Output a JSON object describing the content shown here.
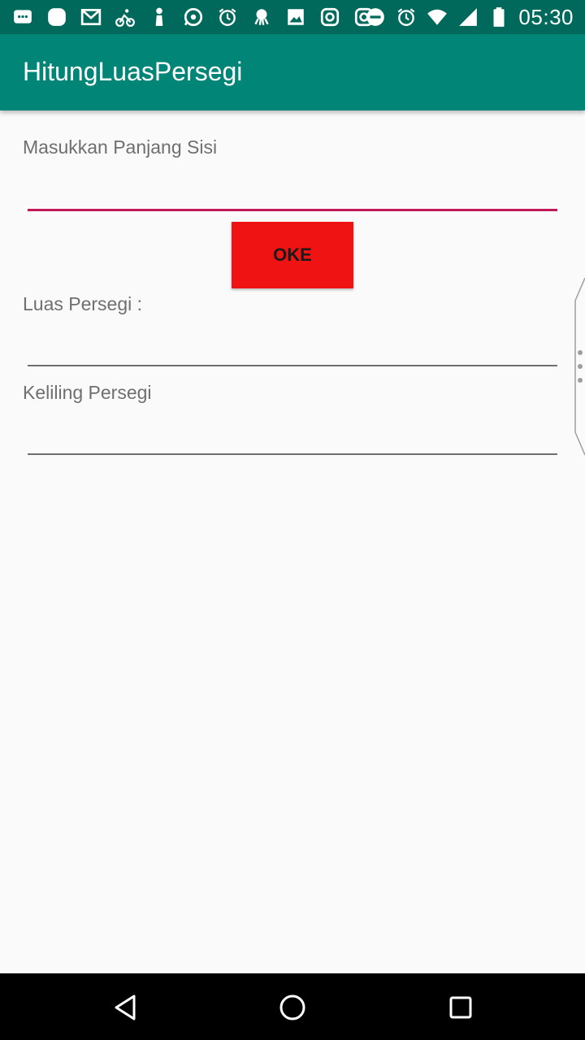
{
  "status_bar": {
    "time": "05:30",
    "icons": [
      "message-icon",
      "blob-icon",
      "gmail-icon",
      "cycling-icon",
      "figure-icon",
      "whatsapp-icon",
      "alarm-icon",
      "octopus-icon",
      "image-icon",
      "instagram-icon",
      "instagram-icon",
      "dnd-icon",
      "alarm-icon",
      "wifi-icon",
      "signal-icon",
      "battery-icon"
    ]
  },
  "app_bar": {
    "title": "HitungLuasPersegi"
  },
  "form": {
    "side_label": "Masukkan Panjang Sisi",
    "side_value": "",
    "button_label": "OKE",
    "area_label": "Luas Persegi :",
    "area_value": "",
    "perimeter_label": "Keliling Persegi",
    "perimeter_value": ""
  },
  "navigation": {
    "buttons": [
      "back-icon",
      "home-icon",
      "recents-icon"
    ]
  },
  "colors": {
    "status_bar": "#00695c",
    "app_bar": "#008577",
    "accent": "#c2185b",
    "button": "#f01313"
  }
}
